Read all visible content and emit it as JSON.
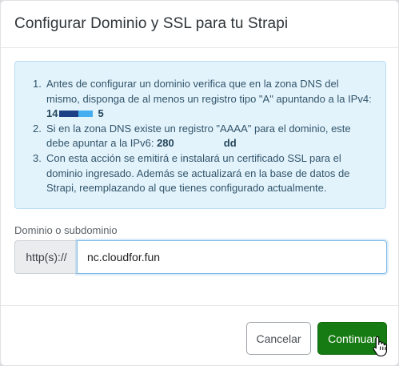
{
  "modal": {
    "title": "Configurar Dominio y SSL para tu Strapi"
  },
  "info": {
    "items": [
      {
        "num": "1.",
        "text": "Antes de configurar un dominio verifica que en la zona DNS del mismo, disponga de al menos un registro tipo \"A\" apuntando a la IPv4:",
        "ip_start": "14",
        "ip_end": "5"
      },
      {
        "num": "2.",
        "text": "Si en la zona DNS existe un registro \"AAAA\" para el dominio, este debe apuntar a la IPv6:",
        "ip_start": "280",
        "ip_end": "dd"
      },
      {
        "num": "3.",
        "text": "Con esta acción se emitirá e instalará un certificado SSL para el dominio ingresado. Además se actualizará en la base de datos de Strapi, reemplazando al que tienes configurado actualmente."
      }
    ]
  },
  "form": {
    "label": "Dominio o subdominio",
    "prefix": "http(s)://",
    "value": "nc.cloudfor.fun"
  },
  "footer": {
    "cancel_label": "Cancelar",
    "continue_label": "Continuar"
  },
  "colors": {
    "primary": "#177b13",
    "info_bg": "#e3f3fc",
    "info_border": "#b8dcf2"
  },
  "icons": {
    "cursor": "hand-pointer-icon"
  }
}
